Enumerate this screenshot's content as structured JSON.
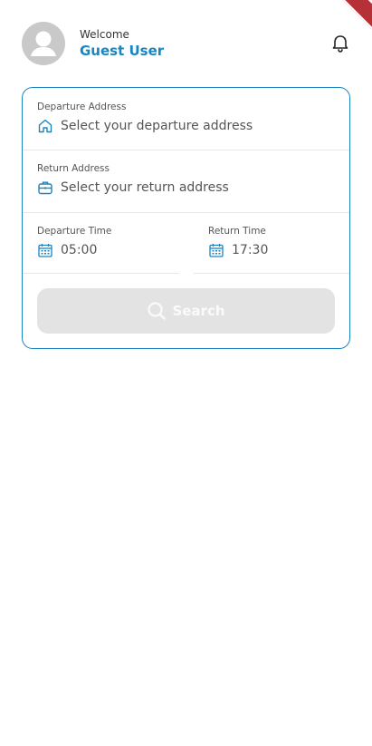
{
  "header": {
    "welcome": "Welcome",
    "username": "Guest User"
  },
  "form": {
    "departure_address": {
      "label": "Departure Address",
      "placeholder": "Select your departure address"
    },
    "return_address": {
      "label": "Return Address",
      "placeholder": "Select your return address"
    },
    "departure_time": {
      "label": "Departure Time",
      "value": "05:00"
    },
    "return_time": {
      "label": "Return Time",
      "value": "17:30"
    },
    "search_label": "Search"
  },
  "colors": {
    "accent": "#1a86bf",
    "button_disabled": "#e3e3e3"
  },
  "icons": [
    "avatar-person-icon",
    "bell-icon",
    "home-icon",
    "briefcase-icon",
    "calendar-icon",
    "search-icon"
  ]
}
